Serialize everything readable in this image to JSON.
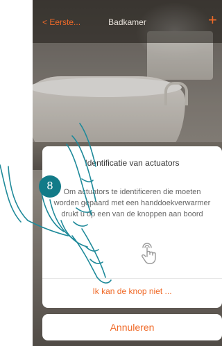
{
  "navbar": {
    "back_label": "Eerste...",
    "title": "Badkamer",
    "add_symbol": "+"
  },
  "dialog": {
    "title": "Identificatie van actuators",
    "body_line1": "Om actuators te identificeren die moeten",
    "body_line2": "worden gepaard met een handdoekverwarmer",
    "body_line3": "drukt u op een van de knoppen aan boord",
    "action_label": "Ik kan de knop niet ..."
  },
  "cancel_label": "Annuleren",
  "step_number": "8",
  "accent_color": "#f06a28",
  "step_badge_color": "#127b88",
  "icons": [
    "back-chevron-icon",
    "add-icon",
    "touch-hand-icon",
    "pointing-hand-illustration"
  ]
}
